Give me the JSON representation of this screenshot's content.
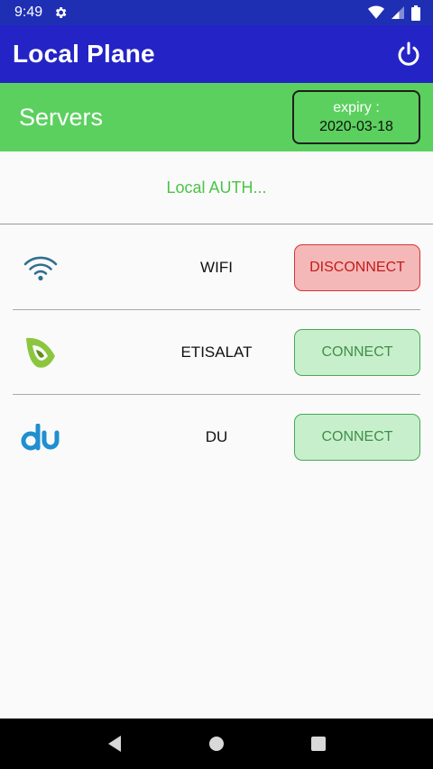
{
  "status_bar": {
    "time": "9:49",
    "icons": [
      "gear-icon",
      "wifi-icon",
      "signal-icon",
      "battery-icon"
    ]
  },
  "app_bar": {
    "title": "Local Plane",
    "power_icon": "power-icon"
  },
  "servers_bar": {
    "title": "Servers",
    "expiry_label": "expiry :",
    "expiry_date": "2020-03-18"
  },
  "auth_status": "Local AUTH...",
  "servers": [
    {
      "name": "WIFI",
      "action": "DISCONNECT",
      "icon": "wifi-icon"
    },
    {
      "name": "ETISALAT",
      "action": "CONNECT",
      "icon": "etisalat-logo-icon"
    },
    {
      "name": "DU",
      "action": "CONNECT",
      "icon": "du-logo-icon"
    }
  ],
  "colors": {
    "status_bar": "#1f2fb4",
    "app_bar": "#2424c6",
    "servers_bar": "#5bd05f",
    "auth_text": "#4cc447",
    "disconnect_bg": "#f4b8b8",
    "disconnect_text": "#c41a1a",
    "connect_bg": "#c8efcc",
    "connect_text": "#3f8f47"
  },
  "nav_bar": {
    "icons": [
      "back-icon",
      "home-icon",
      "recents-icon"
    ]
  }
}
